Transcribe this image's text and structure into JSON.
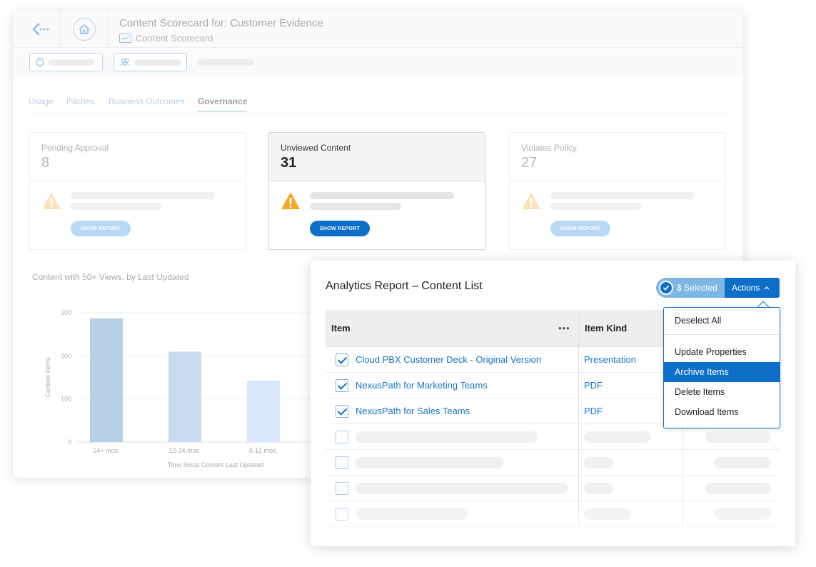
{
  "header": {
    "title": "Content Scorecard for: Customer Evidence",
    "subtitle": "Content Scorecard"
  },
  "tabs": [
    "Usage",
    "Pitches",
    "Business Outcomes",
    "Governance"
  ],
  "active_tab": "Governance",
  "cards": [
    {
      "label": "Pending Approval",
      "value": "8",
      "button": "SHOW REPORT"
    },
    {
      "label": "Unviewed Content",
      "value": "31",
      "button": "SHOW REPORT"
    },
    {
      "label": "Violates Policy",
      "value": "27",
      "button": "SHOW REPORT"
    }
  ],
  "chart_title": "Content with 50+ Views, by Last Updated",
  "chart_data": {
    "type": "bar",
    "title": "Content with 50+ Views, by Last Updated",
    "xlabel": "Time Since Content Last Updated",
    "ylabel": "Content Items",
    "categories": [
      "24+ mos.",
      "12-24 mos.",
      "6-12 mos."
    ],
    "values": [
      287,
      210,
      143
    ],
    "ylim": [
      0,
      300
    ],
    "yticks": [
      0,
      100,
      200,
      300
    ],
    "colors": [
      "#b7cfe6",
      "#cbdbf1",
      "#dae6fb"
    ],
    "grid": true
  },
  "panel": {
    "title": "Analytics Report – Content List",
    "selected_count": "3",
    "selected_label": "Selected",
    "actions_label": "Actions"
  },
  "table": {
    "columns": [
      "Item",
      "Item Kind"
    ],
    "more_icon": "•••",
    "rows": [
      {
        "checked": true,
        "item": "Cloud PBX Customer Deck - Original Version",
        "kind": "Presentation"
      },
      {
        "checked": true,
        "item": "NexusPath for Marketing Teams",
        "kind": "PDF"
      },
      {
        "checked": true,
        "item": "NexusPath for Sales Teams",
        "kind": "PDF"
      }
    ]
  },
  "menu": {
    "items": [
      "Deselect All",
      "Update Properties",
      "Archive Items",
      "Delete Items",
      "Download Items"
    ],
    "active": "Archive Items"
  },
  "colors": {
    "accent": "#0d6fc7",
    "link": "#1b74c4",
    "warning": "#f5a623"
  }
}
